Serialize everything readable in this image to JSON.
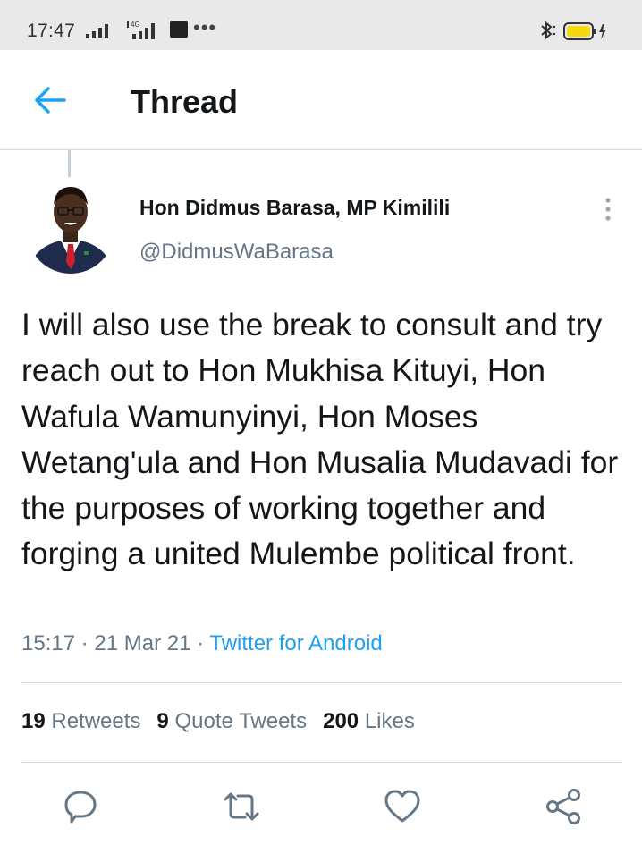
{
  "status_bar": {
    "time": "17:47",
    "network_label": "4G",
    "overflow": "•••",
    "battery_color": "#f5d90a"
  },
  "header": {
    "title": "Thread"
  },
  "tweet": {
    "author_name": "Hon Didmus Barasa, MP Kimilili",
    "author_handle": "@DidmusWaBarasa",
    "text": "I will also use the break to consult and try reach out to Hon Mukhisa Kituyi, Hon Wafula Wamunyinyi, Hon Moses Wetang'ula and Hon Musalia Mudavadi for the purposes of working together and forging a united Mulembe political front.",
    "time": "15:17",
    "date": "21 Mar 21",
    "separator": " · ",
    "source": "Twitter for Android",
    "stats": {
      "retweets_count": "19",
      "retweets_label": "Retweets",
      "quotes_count": "9",
      "quotes_label": "Quote Tweets",
      "likes_count": "200",
      "likes_label": "Likes"
    }
  },
  "colors": {
    "accent": "#1da1f2",
    "secondary_text": "#657786",
    "icon_gray": "#657786"
  },
  "icons": {
    "back": "arrow-left-icon",
    "more": "more-vertical-icon",
    "reply": "reply-bubble-icon",
    "retweet": "retweet-icon",
    "like": "heart-icon",
    "share": "share-icon"
  }
}
